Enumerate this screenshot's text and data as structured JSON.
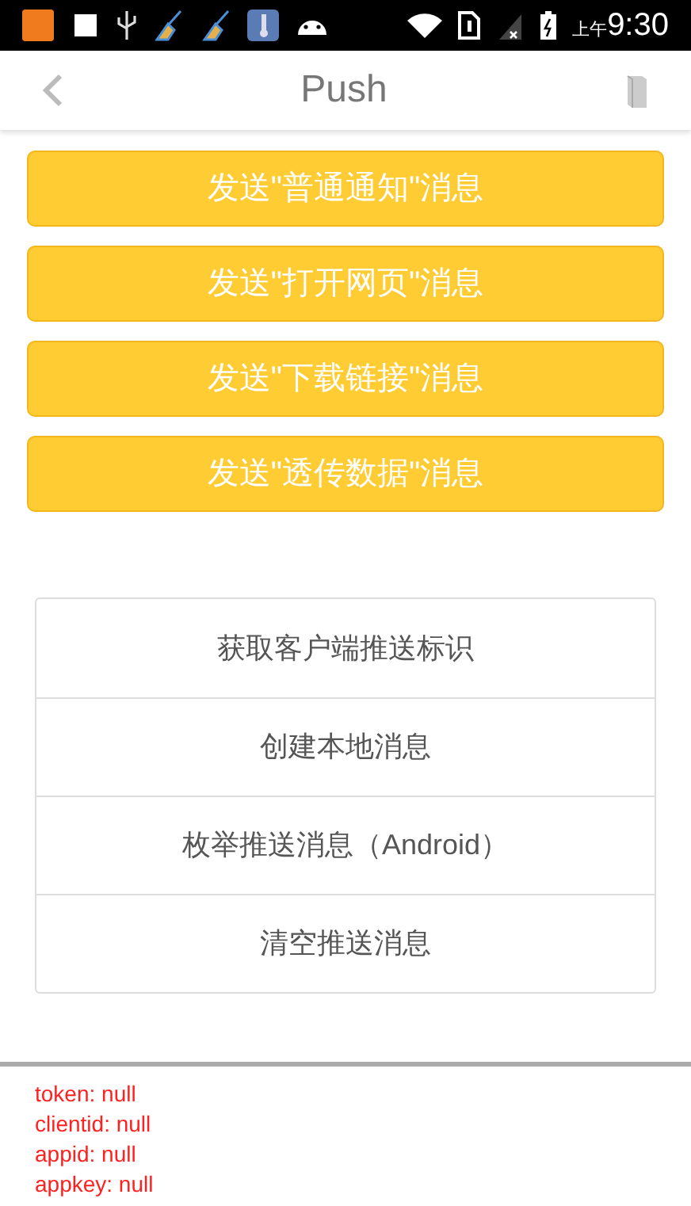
{
  "status_bar": {
    "time_prefix": "上午",
    "time": "9:30"
  },
  "header": {
    "title": "Push"
  },
  "send_buttons": [
    "发送\"普通通知\"消息",
    "发送\"打开网页\"消息",
    "发送\"下载链接\"消息",
    "发送\"透传数据\"消息"
  ],
  "actions": [
    "获取客户端推送标识",
    "创建本地消息",
    "枚举推送消息（Android）",
    "清空推送消息"
  ],
  "log": {
    "lines": [
      "token: null",
      "clientid: null",
      "appid: null",
      "appkey: null"
    ]
  }
}
